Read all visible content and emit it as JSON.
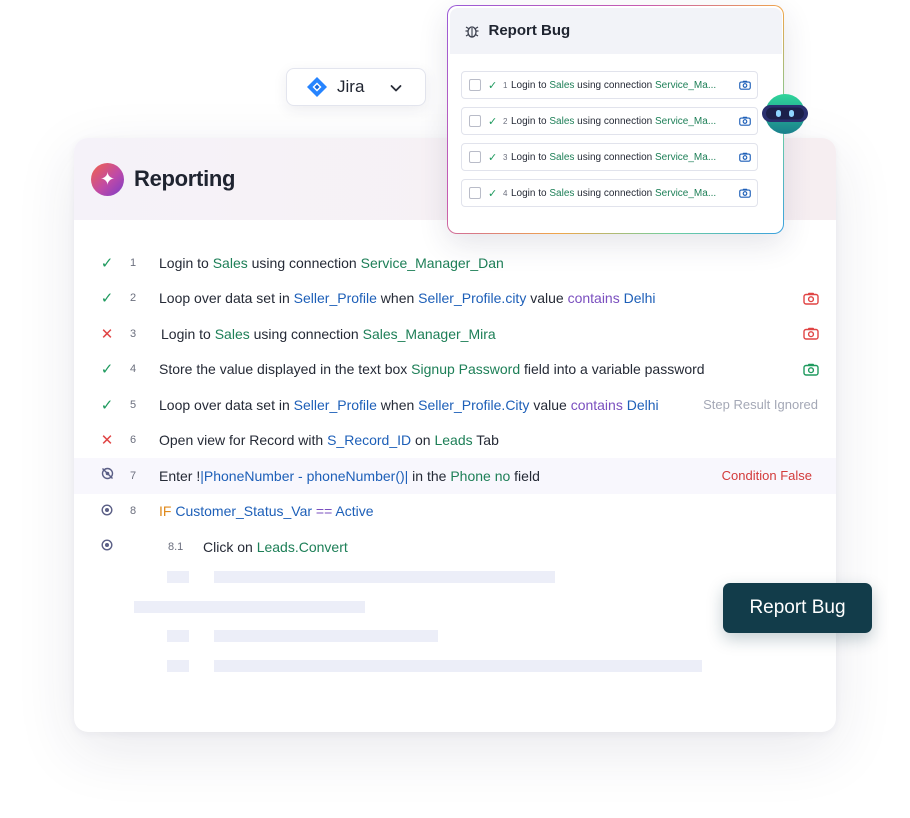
{
  "jira": {
    "label": "Jira",
    "icon": "jira-icon"
  },
  "main": {
    "title": "Reporting"
  },
  "steps": [
    {
      "status": "passed",
      "num": "1",
      "parts": [
        "Login to ",
        "Sales",
        " using connection ",
        "Service_Manager_Dan"
      ]
    },
    {
      "status": "passed",
      "num": "2",
      "parts": [
        "Loop over data set in ",
        "Seller_Profile",
        " when ",
        "Seller_Profile.city",
        " value ",
        "contains",
        " Delhi"
      ]
    },
    {
      "status": "failed",
      "num": "3",
      "parts": [
        "Login to ",
        "Sales",
        " using connection ",
        "Sales_Manager_Mira"
      ]
    },
    {
      "status": "passed",
      "num": "4",
      "parts": [
        "Store the value displayed in the text box ",
        "Signup Password",
        " field into a variable password"
      ]
    },
    {
      "status": "passed",
      "num": "5",
      "parts": [
        "Loop over data set in ",
        "Seller_Profile",
        " when ",
        "Seller_Profile.City",
        " value ",
        "contains",
        " Delhi"
      ],
      "right_text": "Step Result Ignored"
    },
    {
      "status": "failed",
      "num": "6",
      "parts": [
        "Open view for Record with ",
        "S_Record_ID",
        " on ",
        "Leads",
        " Tab"
      ]
    },
    {
      "status": "disabled",
      "num": "7",
      "parts": [
        "Enter !",
        "|PhoneNumber - phoneNumber()|",
        " in the ",
        "Phone no",
        " field"
      ],
      "right_text": "Condition False"
    },
    {
      "status": "skipped",
      "num": "8",
      "parts": [
        "IF",
        " Customer_Status_Var",
        " ==",
        " Active"
      ]
    },
    {
      "status": "skipped",
      "num": "8.1",
      "parts": [
        "Click on ",
        "Leads.Convert"
      ]
    }
  ],
  "popup": {
    "title": "Report Bug",
    "rows": [
      {
        "num": "1",
        "parts": [
          "Login to ",
          "Sales",
          " using connection ",
          "Service_Ma..."
        ]
      },
      {
        "num": "2",
        "parts": [
          "Login to ",
          "Sales",
          " using connection ",
          "Service_Ma..."
        ]
      },
      {
        "num": "3",
        "parts": [
          "Login to ",
          "Sales",
          " using connection ",
          "Service_Ma..."
        ]
      },
      {
        "num": "4",
        "parts": [
          "Login to ",
          "Sales",
          " using connection ",
          "Service_Ma..."
        ]
      }
    ]
  },
  "report_button": {
    "label": "Report Bug"
  },
  "colors": {
    "accent": "#123c4a",
    "pass": "#1e9a5e",
    "fail": "#e04444",
    "keyword": "#1d7f57",
    "variable": "#1d5fb8"
  }
}
